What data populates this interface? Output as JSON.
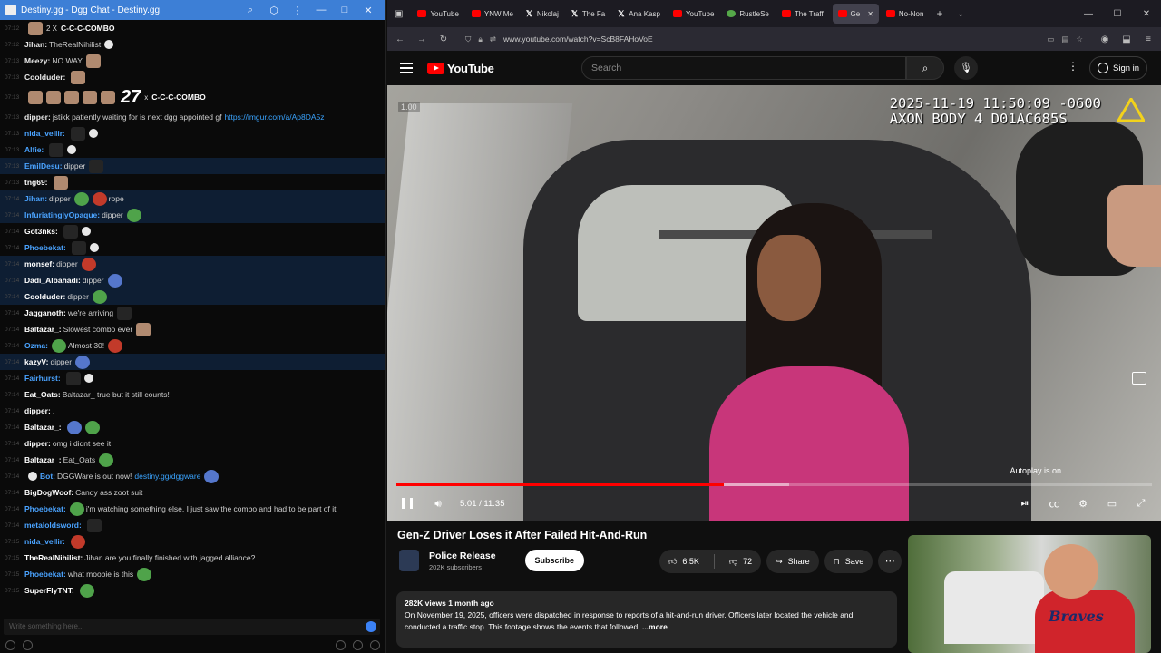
{
  "chat_window": {
    "title": "Destiny.gg - Dgg Chat - Destiny.gg",
    "window_controls": [
      "—",
      "□",
      "✕"
    ],
    "input_placeholder": "Write something here...",
    "messages": [
      {
        "time": "07:12",
        "nick": "",
        "text": "",
        "combo_count": "2 X",
        "combo_label": "C-C-C-COMBO",
        "kind": "combo-small"
      },
      {
        "time": "07:12",
        "nick": "Jihan:",
        "text": "TheRealNihilist",
        "emotes": [
          "white"
        ]
      },
      {
        "time": "07:13",
        "nick": "Meezy:",
        "text": "NO WAY",
        "emotes": [
          "face"
        ]
      },
      {
        "time": "07:13",
        "nick": "Coolduder:",
        "text": "",
        "emotes": [
          "face"
        ]
      },
      {
        "time": "07:13",
        "nick": "",
        "text": "",
        "combo_count": "27",
        "combo_x": "x",
        "combo_label": "C-C-C-COMBO",
        "kind": "combo-big"
      },
      {
        "time": "07:13",
        "nick": "dipper:",
        "text": "jstikk patiently waiting for is next dgg appointed gf",
        "link": "https://imgur.com/a/Ap8DA5z"
      },
      {
        "time": "07:13",
        "nick": "nida_vellir:",
        "text": "",
        "emotes": [
          "dark",
          "white"
        ],
        "blue": true
      },
      {
        "time": "07:13",
        "nick": "Alfie:",
        "text": "",
        "emotes": [
          "dark",
          "white"
        ],
        "blue": true
      },
      {
        "time": "07:13",
        "nick": "EmilDesu:",
        "text": "dipper",
        "emotes": [
          "dark"
        ],
        "blue": true,
        "hl": true
      },
      {
        "time": "07:13",
        "nick": "tng69:",
        "text": "",
        "emotes": [
          "face"
        ],
        "white": true
      },
      {
        "time": "07:14",
        "nick": "Jihan:",
        "text": "dipper",
        "emotes": [
          "green",
          "red"
        ],
        "after": "rope",
        "blue": true,
        "hl": true
      },
      {
        "time": "07:14",
        "nick": "InfuriatinglyOpaque:",
        "text": "dipper",
        "emotes": [
          "green"
        ],
        "blue": true,
        "hl": true
      },
      {
        "time": "07:14",
        "nick": "Got3nks:",
        "text": "",
        "emotes": [
          "dark",
          "white"
        ],
        "white": true
      },
      {
        "time": "07:14",
        "nick": "Phoebekat:",
        "text": "",
        "emotes": [
          "dark",
          "white"
        ],
        "blue": true
      },
      {
        "time": "07:14",
        "nick": "monsef:",
        "text": "dipper",
        "emotes": [
          "red"
        ],
        "white": true,
        "hl": true
      },
      {
        "time": "07:14",
        "nick": "Dadi_Albahadi:",
        "text": "dipper",
        "emotes": [
          "blue"
        ],
        "white": true,
        "hl": true
      },
      {
        "time": "07:14",
        "nick": "Coolduder:",
        "text": "dipper",
        "emotes": [
          "green"
        ],
        "white": true,
        "hl": true
      },
      {
        "time": "07:14",
        "nick": "Jagganoth:",
        "text": "we're arriving",
        "emotes": [
          "dark"
        ],
        "white": true
      },
      {
        "time": "07:14",
        "nick": "Baltazar_:",
        "text": "Slowest combo ever",
        "emotes": [
          "face"
        ],
        "white": true
      },
      {
        "time": "07:14",
        "nick": "Ozma:",
        "text": "Almost 30!",
        "emotes": [
          "red"
        ],
        "blue": true,
        "pre_emote": true
      },
      {
        "time": "07:14",
        "nick": "kazyV:",
        "text": "dipper",
        "emotes": [
          "blue"
        ],
        "white": true,
        "hl": true
      },
      {
        "time": "07:14",
        "nick": "Fairhurst:",
        "text": "",
        "emotes": [
          "dark",
          "white"
        ],
        "blue": true
      },
      {
        "time": "07:14",
        "nick": "Eat_Oats:",
        "text": "Baltazar_ true but it still counts!",
        "white": true
      },
      {
        "time": "07:14",
        "nick": "dipper:",
        "text": ".",
        "white": true
      },
      {
        "time": "07:14",
        "nick": "Baltazar_:",
        "text": "",
        "emotes": [
          "blue",
          "green"
        ],
        "white": true
      },
      {
        "time": "07:14",
        "nick": "dipper:",
        "text": "omg i didnt see it",
        "white": true
      },
      {
        "time": "07:14",
        "nick": "Baltazar_:",
        "text": "Eat_Oats",
        "emotes": [
          "green"
        ],
        "white": true
      },
      {
        "time": "07:14",
        "nick": "Bot:",
        "text": "DGGWare is out now!",
        "link": "destiny.gg/dggware",
        "emotes": [
          "blue"
        ],
        "blue": true,
        "bot": true
      },
      {
        "time": "07:14",
        "nick": "BigDogWoof:",
        "text": "Candy ass zoot suit",
        "white": true
      },
      {
        "time": "07:14",
        "nick": "Phoebekat:",
        "text": "i'm watching something else, I just saw the combo and had to be part of it",
        "blue": true,
        "pre_emote": true
      },
      {
        "time": "07:14",
        "nick": "metaloldsword:",
        "text": "",
        "emotes": [
          "dark"
        ],
        "blue": true
      },
      {
        "time": "07:15",
        "nick": "nida_vellir:",
        "text": "",
        "emotes": [
          "red"
        ],
        "blue": true
      },
      {
        "time": "07:15",
        "nick": "TheRealNihilist:",
        "text": "Jihan are you finally finished with jagged alliance?",
        "white": true
      },
      {
        "time": "07:15",
        "nick": "Phoebekat:",
        "text": "what moobie is this",
        "emotes": [
          "green"
        ],
        "blue": true
      },
      {
        "time": "07:15",
        "nick": "SuperFlyTNT:",
        "text": "",
        "emotes": [
          "green"
        ],
        "white": true
      }
    ]
  },
  "browser": {
    "tabs": [
      {
        "label": "YouTube",
        "fav": "yt"
      },
      {
        "label": "YNW Me",
        "fav": "yt"
      },
      {
        "label": "Nikolaj",
        "fav": "x"
      },
      {
        "label": "The Fa",
        "fav": "x"
      },
      {
        "label": "Ana Kasp",
        "fav": "x"
      },
      {
        "label": "YouTube",
        "fav": "yt"
      },
      {
        "label": "RustleSe",
        "fav": "frog"
      },
      {
        "label": "The Traffi",
        "fav": "yt"
      },
      {
        "label": "Ge",
        "fav": "yt",
        "active": true
      },
      {
        "label": "No-Non",
        "fav": "yt"
      }
    ],
    "url": "www.youtube.com/watch?v=ScB8FAHoVoE"
  },
  "youtube": {
    "logo_text": "YouTube",
    "search_placeholder": "Search",
    "sign_in": "Sign in",
    "video": {
      "bodycam_line1": "2025-11-19 11:50:09 -0600",
      "bodycam_line2": "AXON BODY 4 D01AC685S",
      "speed_badge": "1.00",
      "autoplay": "Autoplay is on",
      "time": "5:01 / 11:35",
      "progress_fraction": 0.433,
      "loaded_fraction": 0.52
    },
    "title": "Gen-Z Driver Loses it After Failed Hit-And-Run",
    "channel": {
      "name": "Police Release",
      "subs": "202K subscribers",
      "subscribe": "Subscribe"
    },
    "actions": {
      "likes": "6.5K",
      "dislikes": "72",
      "share": "Share",
      "save": "Save"
    },
    "description": {
      "meta": "282K views  1 month ago",
      "text": "On November 19, 2025, officers were dispatched in response to reports of a hit-and-run driver. Officers later located the vehicle and conducted a traffic stop. This footage shows the events that followed.",
      "more": "...more"
    },
    "side_thumb_text": "Braves"
  }
}
